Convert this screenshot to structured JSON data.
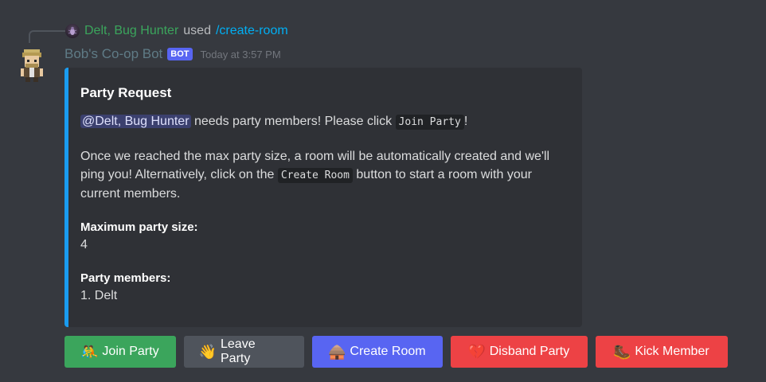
{
  "reply": {
    "user": "Delt, Bug Hunter",
    "used": "used",
    "command": "/create-room"
  },
  "message": {
    "bot_name": "Bob's Co-op Bot",
    "bot_tag": "BOT",
    "timestamp": "Today at 3:57 PM"
  },
  "embed": {
    "accent_color": "#1a9cf0",
    "title": "Party Request",
    "line1": {
      "mention": "@Delt, Bug Hunter",
      "text_before_code": "needs party members! Please click",
      "code": "Join Party",
      "text_after_code": "!"
    },
    "line2": {
      "text_before_code": "Once we reached the max party size, a room will be automatically created and we'll ping you! Alternatively, click on the",
      "code": "Create Room",
      "text_after_code": "button to start a room with your current members."
    },
    "fields": [
      {
        "name": "Maximum party size:",
        "value": "4"
      },
      {
        "name": "Party members:",
        "value": "1. Delt"
      }
    ]
  },
  "buttons": [
    {
      "label": "Join Party",
      "icon": "people-wrestling-icon",
      "emoji": "🤼",
      "color": "#3ba55c"
    },
    {
      "label": "Leave Party",
      "icon": "waving-hand-icon",
      "emoji": "👋",
      "color": "#4f545c"
    },
    {
      "label": "Create Room",
      "icon": "hut-icon",
      "emoji": "🛖",
      "color": "#5865f2"
    },
    {
      "label": "Disband Party",
      "icon": "broken-heart-icon",
      "emoji": "💔",
      "color": "#ed4245"
    },
    {
      "label": "Kick Member",
      "icon": "boot-icon",
      "emoji": "🥾",
      "color": "#ed4245"
    }
  ]
}
